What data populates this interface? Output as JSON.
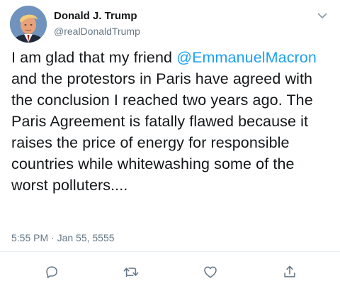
{
  "tweet": {
    "author": {
      "display_name": "Donald J. Trump",
      "handle": "@realDonaldTrump",
      "avatar_icon": "profile-photo"
    },
    "text_before_mention": "I am glad that my friend ",
    "mention": "@EmmanuelMacron",
    "text_after_mention": " and the protestors in Paris have agreed with the conclusion I reached two years ago. The Paris Agreement is fatally flawed because it raises the price of energy for responsible countries while whitewashing some of the worst polluters....",
    "timestamp": "5:55 PM · Jan 55, 5555",
    "colors": {
      "mention": "#1da1f2",
      "text": "#14171a",
      "secondary": "#657786",
      "icon": "#657786"
    }
  },
  "actions": [
    {
      "name": "reply",
      "icon": "reply-icon"
    },
    {
      "name": "retweet",
      "icon": "retweet-icon"
    },
    {
      "name": "like",
      "icon": "like-icon"
    },
    {
      "name": "share",
      "icon": "share-icon"
    }
  ]
}
